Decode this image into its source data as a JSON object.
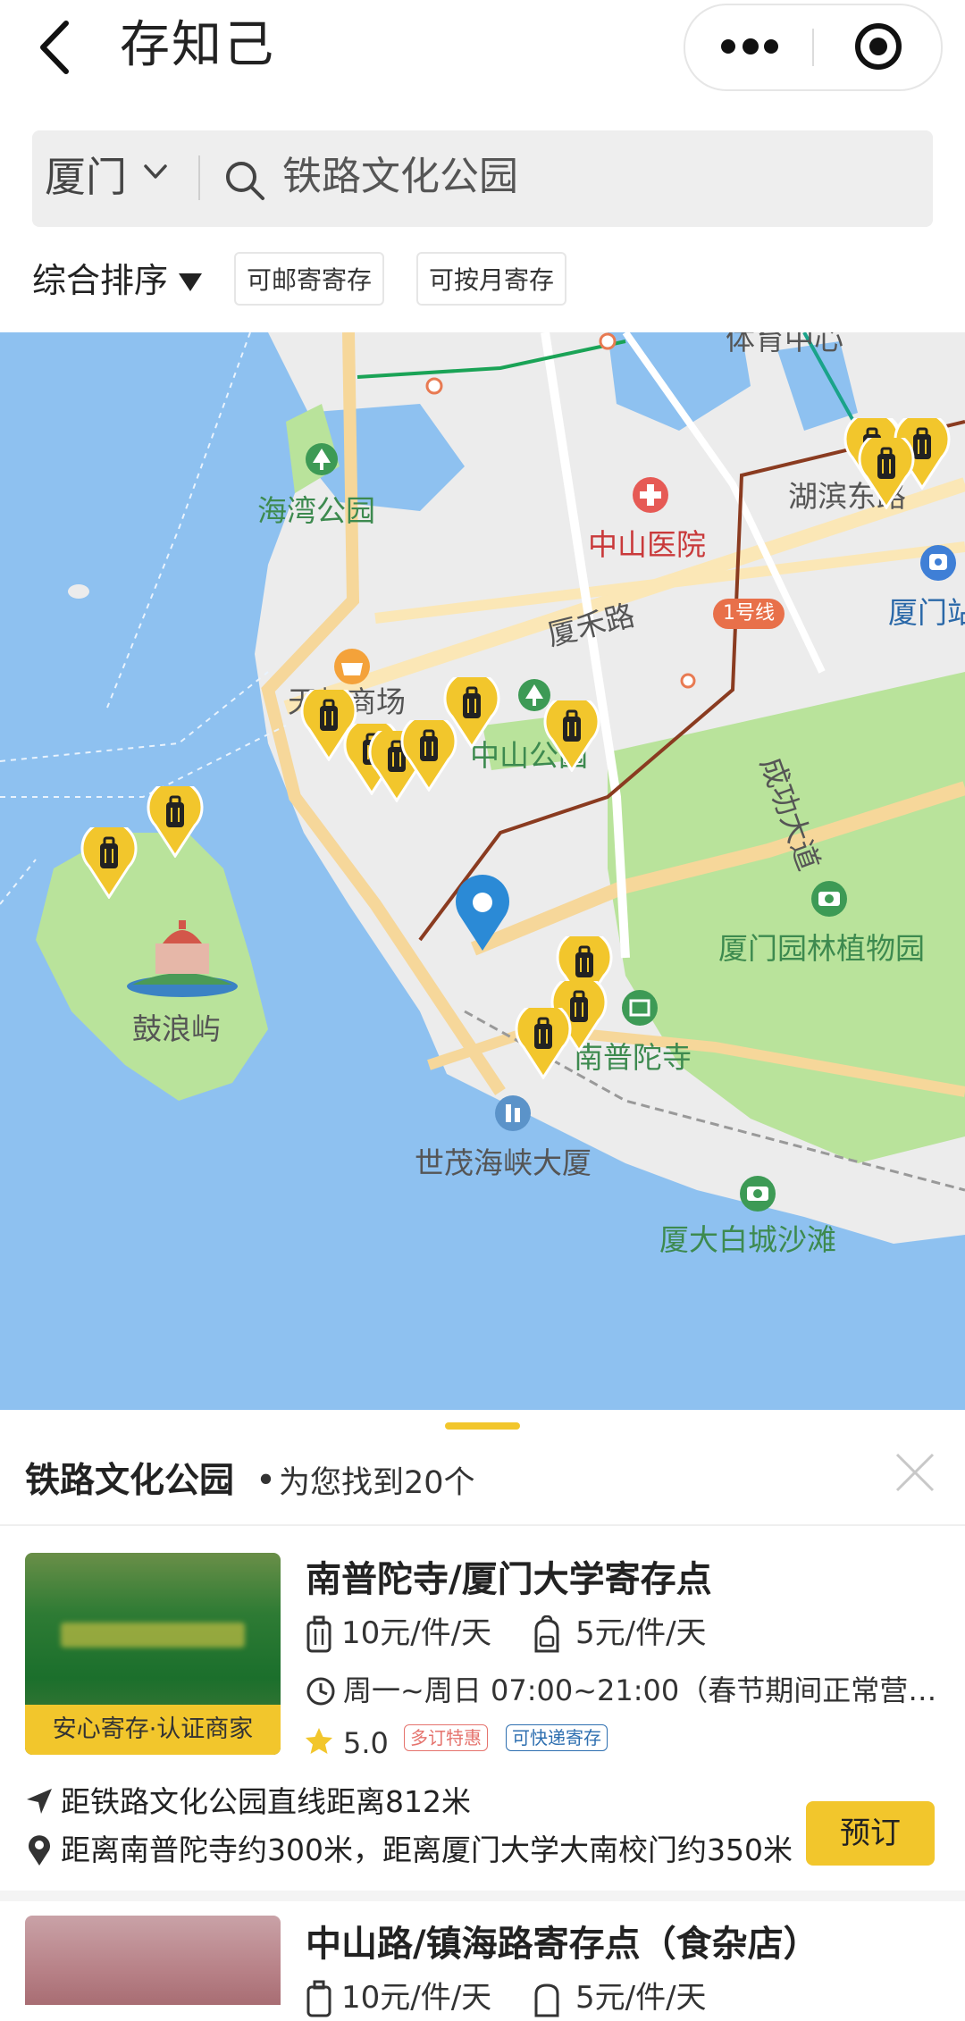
{
  "header": {
    "title": "存知己"
  },
  "search": {
    "city": "厦门",
    "query": "铁路文化公园"
  },
  "filters": {
    "sort": "综合排序",
    "chips": [
      "可邮寄寄存",
      "可按月寄存"
    ]
  },
  "map": {
    "labels": {
      "tiyu": "体育中心",
      "haiwan": "海湾公园",
      "zhongshan_hosp": "中山医院",
      "hubin": "湖滨东路",
      "xiamen_station": "厦门站",
      "xiahe": "厦禾路",
      "line1": "1号线",
      "tianhong": "天虹商场",
      "zhongshan_park": "中山公园",
      "chenggong": "成功大道",
      "gulangyu": "鼓浪屿",
      "botanical": "厦门园林植物园",
      "nanputuo": "南普陀寺",
      "shimao": "世茂海峡大厦",
      "beach": "厦大白城沙滩"
    }
  },
  "results": {
    "location": "铁路文化公园",
    "separator": "•",
    "count_text": "为您找到20个"
  },
  "cards": [
    {
      "name": "南普陀寺/厦门大学寄存点",
      "badge": "安心寄存·认证商家",
      "price_large": "10元/件/天",
      "price_small": "5元/件/天",
      "hours": "周一~周日 07:00~21:00（春节期间正常营…",
      "rating": "5.0",
      "tags": [
        "多订特惠",
        "可快递寄存"
      ],
      "distance": "距铁路文化公园直线距离812米",
      "nearby": "距离南普陀寺约300米，距离厦门大学大南校门约350米",
      "book_label": "预订"
    },
    {
      "name": "中山路/镇海路寄存点（食杂店）",
      "price_large": "10元/件/天",
      "price_small": "5元/件/天"
    }
  ],
  "colors": {
    "accent": "#f2c62c",
    "pin_blue": "#2b8ad6",
    "water": "#8ec1f0",
    "park": "#b9e39b"
  }
}
